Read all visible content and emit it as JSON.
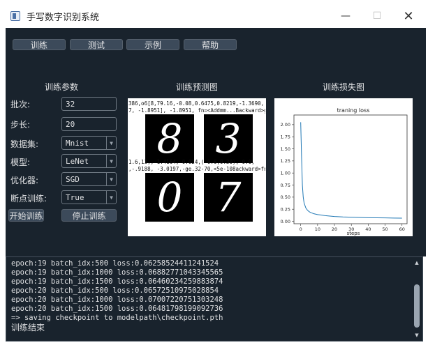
{
  "window": {
    "title": "手写数字识别系统",
    "minimize": "—",
    "maximize": "☐",
    "close": "✕"
  },
  "toolbar": {
    "train": "训练",
    "test": "测试",
    "example": "示例",
    "help": "帮助"
  },
  "sections": {
    "params": "训练参数",
    "prediction": "训练预测图",
    "loss": "训练损失图"
  },
  "params": {
    "batch": {
      "label": "批次:",
      "value": "32"
    },
    "step": {
      "label": "步长:",
      "value": "20"
    },
    "dataset": {
      "label": "数据集:",
      "value": "Mnist"
    },
    "model": {
      "label": "模型:",
      "value": "LeNet"
    },
    "optimizer": {
      "label": "优化器:",
      "value": "SGD"
    },
    "resume": {
      "label": "断点训练:",
      "value": "True"
    }
  },
  "actions": {
    "start": "开始训练",
    "stop": "停止训练"
  },
  "prediction": {
    "digits": [
      "8",
      "3",
      "0",
      "7"
    ],
    "tensor_text": [
      "386,o6[8,79.16,-0.08,0.6475,0.8219,-1.3690,",
      "7, -1.8951], -1.8951, fn=<Addmm...Backward>grad_fn=",
      "1.6,13,,-1.4164,-0.024,(-0.6,0.30),-0.0,",
      ",-.9188, -3.0197,-ge.32-70,<5e-108ackward>fn=<"
    ]
  },
  "chart_data": {
    "type": "line",
    "title": "traning loss",
    "xlabel": "steps",
    "ylabel": "",
    "xlim": [
      -4,
      63
    ],
    "ylim": [
      -0.05,
      2.2
    ],
    "xticks": [
      0,
      10,
      20,
      30,
      40,
      50,
      60
    ],
    "yticks": [
      0.0,
      0.25,
      0.5,
      0.75,
      1.0,
      1.25,
      1.5,
      1.75,
      2.0
    ],
    "x": [
      0,
      0.5,
      1,
      1.5,
      2,
      3,
      4,
      5,
      6,
      8,
      10,
      12,
      15,
      20,
      25,
      30,
      35,
      40,
      45,
      50,
      55,
      60
    ],
    "y": [
      2.05,
      1.35,
      0.75,
      0.5,
      0.38,
      0.28,
      0.23,
      0.2,
      0.18,
      0.155,
      0.14,
      0.13,
      0.115,
      0.1,
      0.09,
      0.085,
      0.08,
      0.075,
      0.072,
      0.07,
      0.068,
      0.065
    ],
    "color": "#1f77b4",
    "grid": false
  },
  "log": {
    "lines": [
      "epoch:19 batch_idx:500 loss:0.06258524411241524",
      "epoch:19 batch_idx:1000 loss:0.06882771043345565",
      "epoch:19 batch_idx:1500 loss:0.06460234259883874",
      "epoch:20 batch_idx:500 loss:0.06572510975028854",
      "epoch:20 batch_idx:1000 loss:0.07007220751303248",
      "epoch:20 batch_idx:1500 loss:0.06481798199092736",
      "=> saving checkpoint to modelpath\\checkpoint.pth"
    ],
    "final": "训练结束"
  }
}
